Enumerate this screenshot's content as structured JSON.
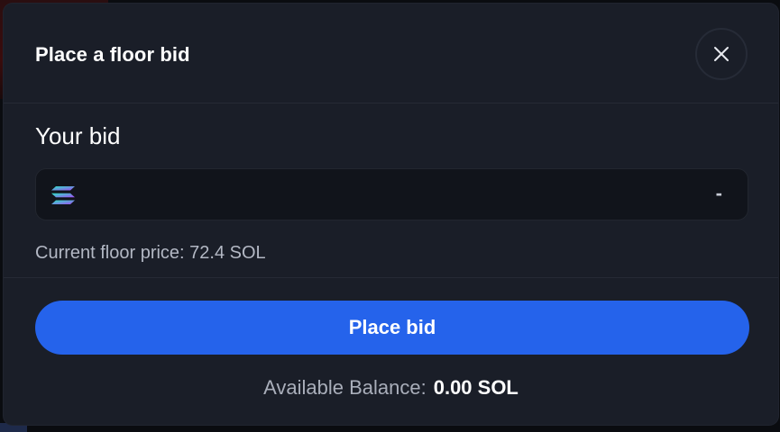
{
  "modal": {
    "title": "Place a floor bid",
    "close_icon": "close-icon"
  },
  "bid": {
    "label": "Your bid",
    "token_icon": "solana-icon",
    "input_value": "",
    "amount_display": "-",
    "floor_price_text": "Current floor price: 72.4 SOL"
  },
  "actions": {
    "place_bid_label": "Place bid"
  },
  "balance": {
    "label": "Available Balance:",
    "value": "0.00 SOL"
  },
  "colors": {
    "modal_bg": "#1a1e28",
    "input_bg": "#11141b",
    "accent": "#2563eb",
    "text_primary": "#ffffff",
    "text_muted": "#b3b8c4"
  }
}
